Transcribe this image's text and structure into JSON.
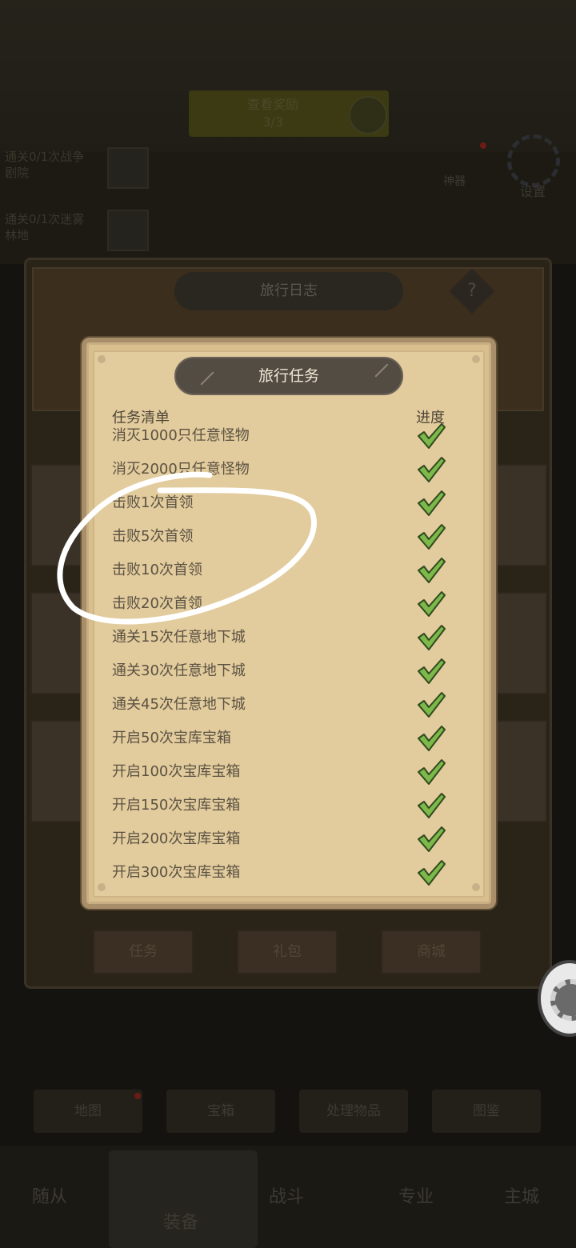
{
  "background": {
    "top_banner": {
      "line1": "查看奖励",
      "line2": "3/3"
    },
    "side_quests": [
      "通关0/1次战争剧院",
      "通关0/1次迷雾林地"
    ],
    "artifact_label": "神器",
    "settings_label": "设置",
    "outer_panel_title": "旅行日志",
    "outer_help": "?",
    "outer_buttons": [
      "任务",
      "礼包",
      "商城"
    ],
    "bottom_tabs": [
      "地图",
      "宝箱",
      "处理物品",
      "图鉴"
    ],
    "nav": [
      "随从",
      "装备",
      "战斗",
      "专业",
      "主城"
    ]
  },
  "dialog": {
    "title": "旅行任务",
    "list_header": "任务清单",
    "progress_header": "进度",
    "tasks": [
      {
        "name": "消灭1000只任意怪物",
        "done": true
      },
      {
        "name": "消灭2000只任意怪物",
        "done": true
      },
      {
        "name": "击败1次首领",
        "done": true
      },
      {
        "name": "击败5次首领",
        "done": true
      },
      {
        "name": "击败10次首领",
        "done": true
      },
      {
        "name": "击败20次首领",
        "done": true
      },
      {
        "name": "通关15次任意地下城",
        "done": true
      },
      {
        "name": "通关30次任意地下城",
        "done": true
      },
      {
        "name": "通关45次任意地下城",
        "done": true
      },
      {
        "name": "开启50次宝库宝箱",
        "done": true
      },
      {
        "name": "开启100次宝库宝箱",
        "done": true
      },
      {
        "name": "开启150次宝库宝箱",
        "done": true
      },
      {
        "name": "开启200次宝库宝箱",
        "done": true
      },
      {
        "name": "开启300次宝库宝箱",
        "done": true
      }
    ]
  },
  "colors": {
    "check_fill": "#7cb84a",
    "check_stroke": "#2f4a1e",
    "annotation": "#ffffff"
  }
}
